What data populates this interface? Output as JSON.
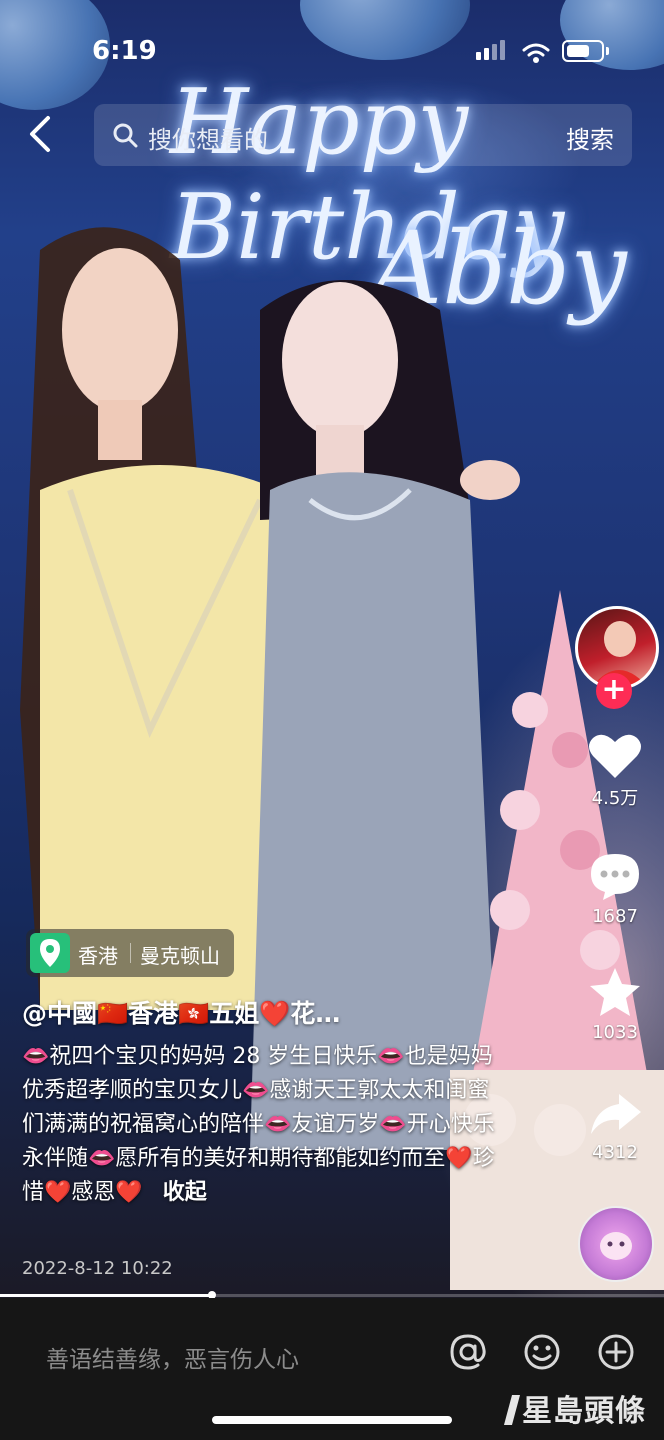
{
  "status_bar": {
    "time": "6:19"
  },
  "search": {
    "placeholder": "搜你想看的",
    "button_label": "搜索"
  },
  "video_overlay": {
    "neon_line1": "Happy Birthday",
    "neon_line2": "Abby"
  },
  "actions": {
    "like_count": "4.5万",
    "comment_count": "1687",
    "favorite_count": "1033",
    "share_count": "4312"
  },
  "location": {
    "city": "香港",
    "district": "曼克顿山"
  },
  "post": {
    "username": "@中國🇨🇳香港🇭🇰五姐❤️花…",
    "caption": "👄祝四个宝贝的妈妈 28 岁生日快乐👄也是妈妈优秀超孝顺的宝贝女儿👄感谢天王郭太太和闺蜜们满满的祝福窝心的陪伴👄友谊万岁👄开心快乐永伴随👄愿所有的美好和期待都能如约而至❤️珍惜❤️感恩❤️",
    "collapse_label": "收起",
    "date": "2022-8-12 10:22"
  },
  "progress": {
    "fraction": 0.32
  },
  "comment_bar": {
    "placeholder": "善语结善缘，恶言伤人心"
  },
  "watermark": "星島頭條",
  "icons": [
    "back-icon",
    "search-icon",
    "heart-icon",
    "comment-icon",
    "star-icon",
    "share-icon",
    "location-pin-icon",
    "at-icon",
    "emoji-icon",
    "add-icon"
  ],
  "colors": {
    "follow": "#fe2c55",
    "location_pin": "#27c07a",
    "bottom_bar": "#161616"
  }
}
